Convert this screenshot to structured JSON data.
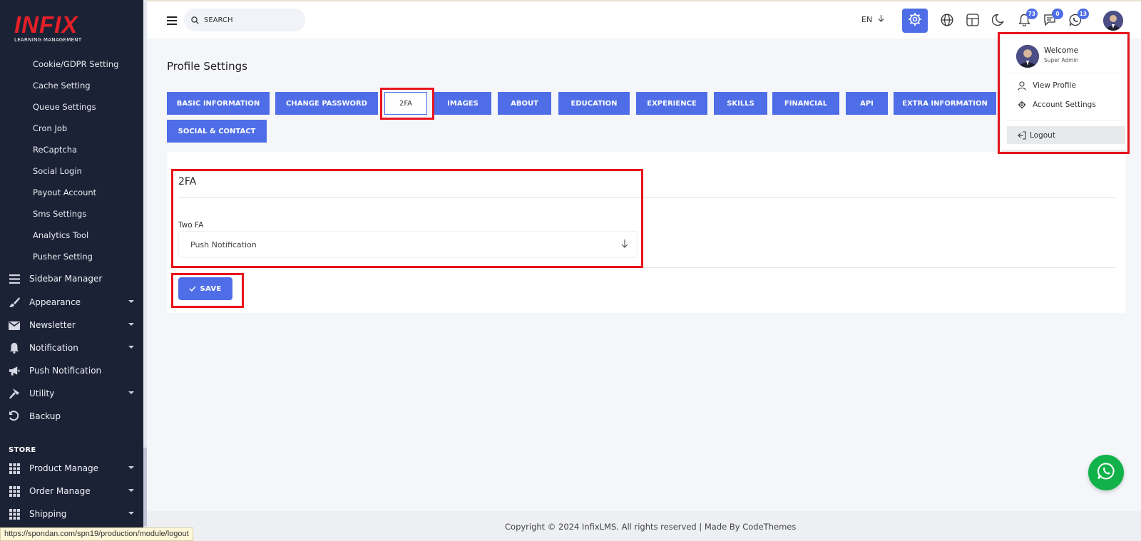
{
  "brand": {
    "logo_text": "INFIX",
    "logo_subtitle": "LEARNING MANAGEMENT",
    "accent_color": "#4e6de6",
    "logo_color": "#e32027"
  },
  "sidebar": {
    "sub_items": [
      {
        "label": "Cookie/GDPR Setting"
      },
      {
        "label": "Cache Setting"
      },
      {
        "label": "Queue Settings"
      },
      {
        "label": "Cron Job"
      },
      {
        "label": "ReCaptcha"
      },
      {
        "label": "Social Login"
      },
      {
        "label": "Payout Account"
      },
      {
        "label": "Sms Settings"
      },
      {
        "label": "Analytics Tool"
      },
      {
        "label": "Pusher Setting"
      }
    ],
    "menu_items": [
      {
        "label": "Sidebar Manager",
        "icon": "list-icon"
      },
      {
        "label": "Appearance",
        "icon": "brush-icon"
      },
      {
        "label": "Newsletter",
        "icon": "envelope-icon"
      },
      {
        "label": "Notification",
        "icon": "bell-icon"
      },
      {
        "label": "Push Notification",
        "icon": "megaphone-icon"
      },
      {
        "label": "Utility",
        "icon": "hammer-icon"
      },
      {
        "label": "Backup",
        "icon": "undo-icon"
      }
    ],
    "store_heading": "STORE",
    "store_items": [
      {
        "label": "Product Manage",
        "icon": "grid-icon"
      },
      {
        "label": "Order Manage",
        "icon": "grid-icon"
      },
      {
        "label": "Shipping",
        "icon": "grid-icon"
      }
    ]
  },
  "topbar": {
    "search_placeholder": "SEARCH",
    "language": "EN",
    "notification_count": "73",
    "message_count": "0",
    "chat_count": "13"
  },
  "main": {
    "page_title": "Profile Settings",
    "tabs": [
      {
        "label": "BASIC INFORMATION"
      },
      {
        "label": "CHANGE PASSWORD"
      },
      {
        "label": "2FA",
        "active": true
      },
      {
        "label": "IMAGES"
      },
      {
        "label": "ABOUT"
      },
      {
        "label": "EDUCATION"
      },
      {
        "label": "EXPERIENCE"
      },
      {
        "label": "SKILLS"
      },
      {
        "label": "FINANCIAL"
      },
      {
        "label": "API"
      },
      {
        "label": "EXTRA INFORMATION"
      },
      {
        "label": "SOCIAL & CONTACT"
      }
    ],
    "card_title": "2FA",
    "field_label": "Two FA",
    "field_value": "Push Notification",
    "save_label": "SAVE"
  },
  "user_menu": {
    "welcome": "Welcome",
    "role": "Super Admin",
    "view_profile": "View Profile",
    "account_settings": "Account Settings",
    "logout": "Logout"
  },
  "footer": {
    "copyright": "Copyright © 2024 InfixLMS. All rights reserved | Made By CodeThemes"
  },
  "status_bar": {
    "url": "https://spondan.com/spn19/production/module/logout"
  }
}
